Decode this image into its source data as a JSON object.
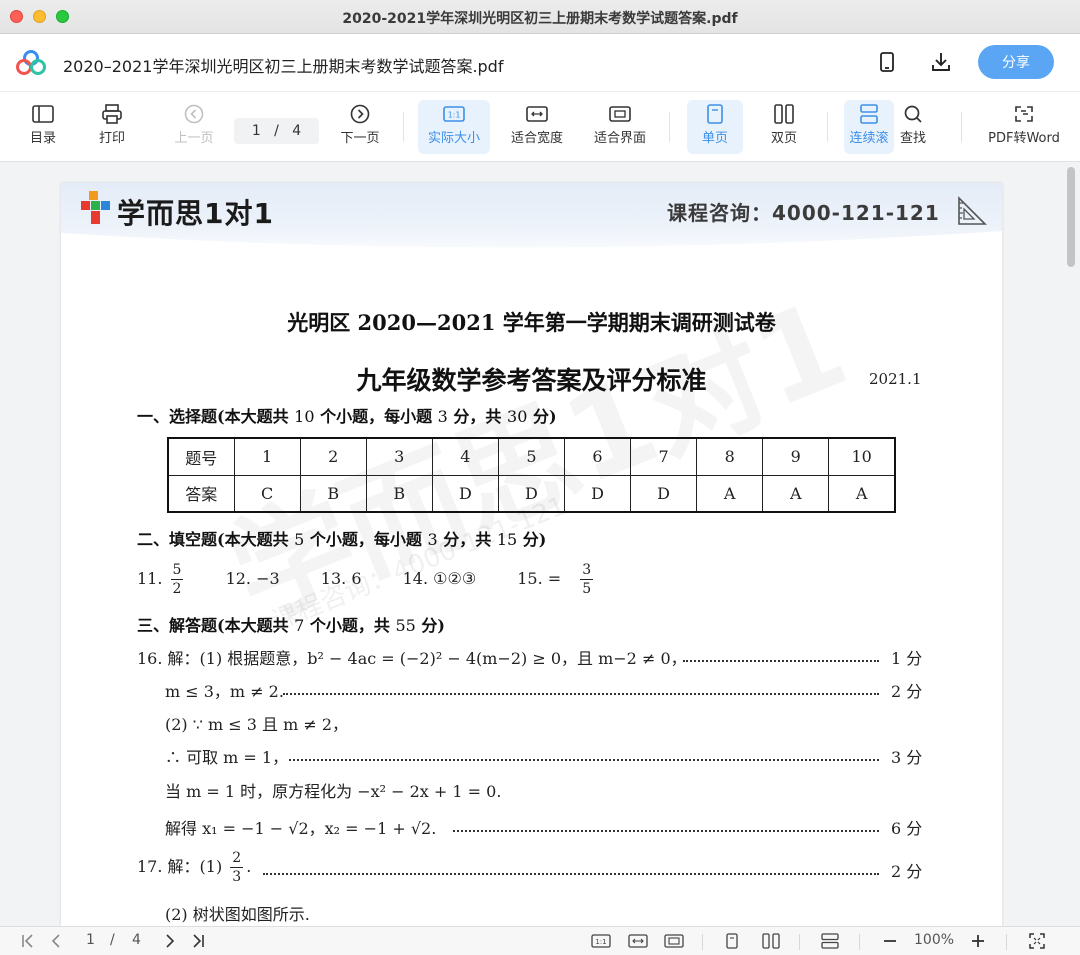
{
  "window": {
    "title": "2020-2021学年深圳光明区初三上册期末考数学试题答案.pdf"
  },
  "appbar": {
    "doc_title": "2020–2021学年深圳光明区初三上册期末考数学试题答案.pdf",
    "share_label": "分享"
  },
  "toolbar": {
    "toc": "目录",
    "print": "打印",
    "prev": "上一页",
    "page_current": "1",
    "page_sep": "/",
    "page_total": "4",
    "next": "下一页",
    "actual_size": "实际大小",
    "fit_width": "适合宽度",
    "fit_page": "适合界面",
    "single": "单页",
    "double": "双页",
    "continuous": "连续滚",
    "search": "查找",
    "pdf2word": "PDF转Word"
  },
  "page": {
    "brand": "学而思1对1",
    "consult": "课程咨询：4000-121-121",
    "watermark": "学而思1对1",
    "watermark_phone": "课程咨询：4000-121-121",
    "heading1": "光明区 2020—2021 学年第一学期期末调研测试卷",
    "heading2": "九年级数学参考答案及评分标准",
    "date": "2021.1",
    "section1": {
      "a": "一、选择题(本大题共 ",
      "b": "10",
      "c": " 个小题，每小题 ",
      "d": "3",
      "e": " 分，共 ",
      "f": "30",
      "g": " 分)"
    },
    "table": {
      "row1_label": "题号",
      "row2_label": "答案",
      "numbers": [
        "1",
        "2",
        "3",
        "4",
        "5",
        "6",
        "7",
        "8",
        "9",
        "10"
      ],
      "answers": [
        "C",
        "B",
        "B",
        "D",
        "D",
        "D",
        "D",
        "A",
        "A",
        "A"
      ]
    },
    "section2": {
      "a": "二、填空题(本大题共 ",
      "b": "5",
      "c": " 个小题，每小题 ",
      "d": "3",
      "e": " 分，共 ",
      "f": "15",
      "g": " 分)"
    },
    "fill": {
      "q11": "11.",
      "q11_num": "5",
      "q11_den": "2",
      "q12": "12. −3",
      "q13": "13. 6",
      "q14": "14. ①②③",
      "q15": "15. =",
      "q15_num": "3",
      "q15_den": "5"
    },
    "section3": {
      "a": "三、解答题(本大题共 ",
      "b": "7",
      "c": " 个小题，共 ",
      "d": "55",
      "e": " 分)"
    },
    "q16": {
      "l1": "16. 解：(1) 根据题意，b² − 4ac = (−2)² − 4(m−2) ≥ 0，且 m−2 ≠ 0，",
      "l1_score": "1 分",
      "l2": "m ≤ 3，m ≠ 2.",
      "l2_score": "2 分",
      "l3": "(2) ∵ m ≤ 3 且 m ≠ 2，",
      "l4": "∴ 可取 m = 1，",
      "l4_score": "3 分",
      "l5": "当 m = 1 时，原方程化为 −x² − 2x + 1 = 0.",
      "l6": "解得 x₁ = −1 − √2，x₂ = −1 + √2.",
      "l6_score": "6 分"
    },
    "q17": {
      "l1": "17. 解：(1)",
      "l1_num": "2",
      "l1_den": "3",
      "l1_end": ".",
      "l1_score": "2 分",
      "l2": "(2) 树状图如图所示."
    }
  },
  "statusbar": {
    "page_current": "1",
    "page_sep": "/",
    "page_total": "4",
    "zoom": "100%"
  },
  "colors": {
    "accent": "#5aa6f4",
    "active_bg": "#e8f2fd",
    "active_text": "#3d8fe8"
  }
}
